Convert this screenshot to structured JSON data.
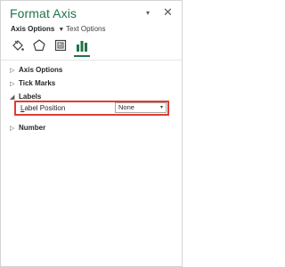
{
  "pane": {
    "title": "Format Axis",
    "dropdown_glyph": "▾",
    "close_glyph": "✕"
  },
  "tabs": {
    "active": "Axis Options",
    "active_arrow": "▼",
    "inactive": "Text Options"
  },
  "category_icons": [
    "fill-line-icon",
    "effects-icon",
    "size-properties-icon",
    "axis-options-icon"
  ],
  "sections": [
    {
      "label": "Axis Options",
      "expanded": false,
      "chevron": "▷"
    },
    {
      "label": "Tick Marks",
      "expanded": false,
      "chevron": "▷"
    },
    {
      "label": "Labels",
      "expanded": true,
      "chevron": "◢"
    },
    {
      "label": "Number",
      "expanded": false,
      "chevron": "▷"
    }
  ],
  "labels_section": {
    "label_position_prefix": "L",
    "label_position_rest": "abel Position",
    "label_position_value": "None",
    "select_arrow": "▾"
  },
  "colors": {
    "accent": "#217346",
    "highlight": "#e03c31"
  }
}
